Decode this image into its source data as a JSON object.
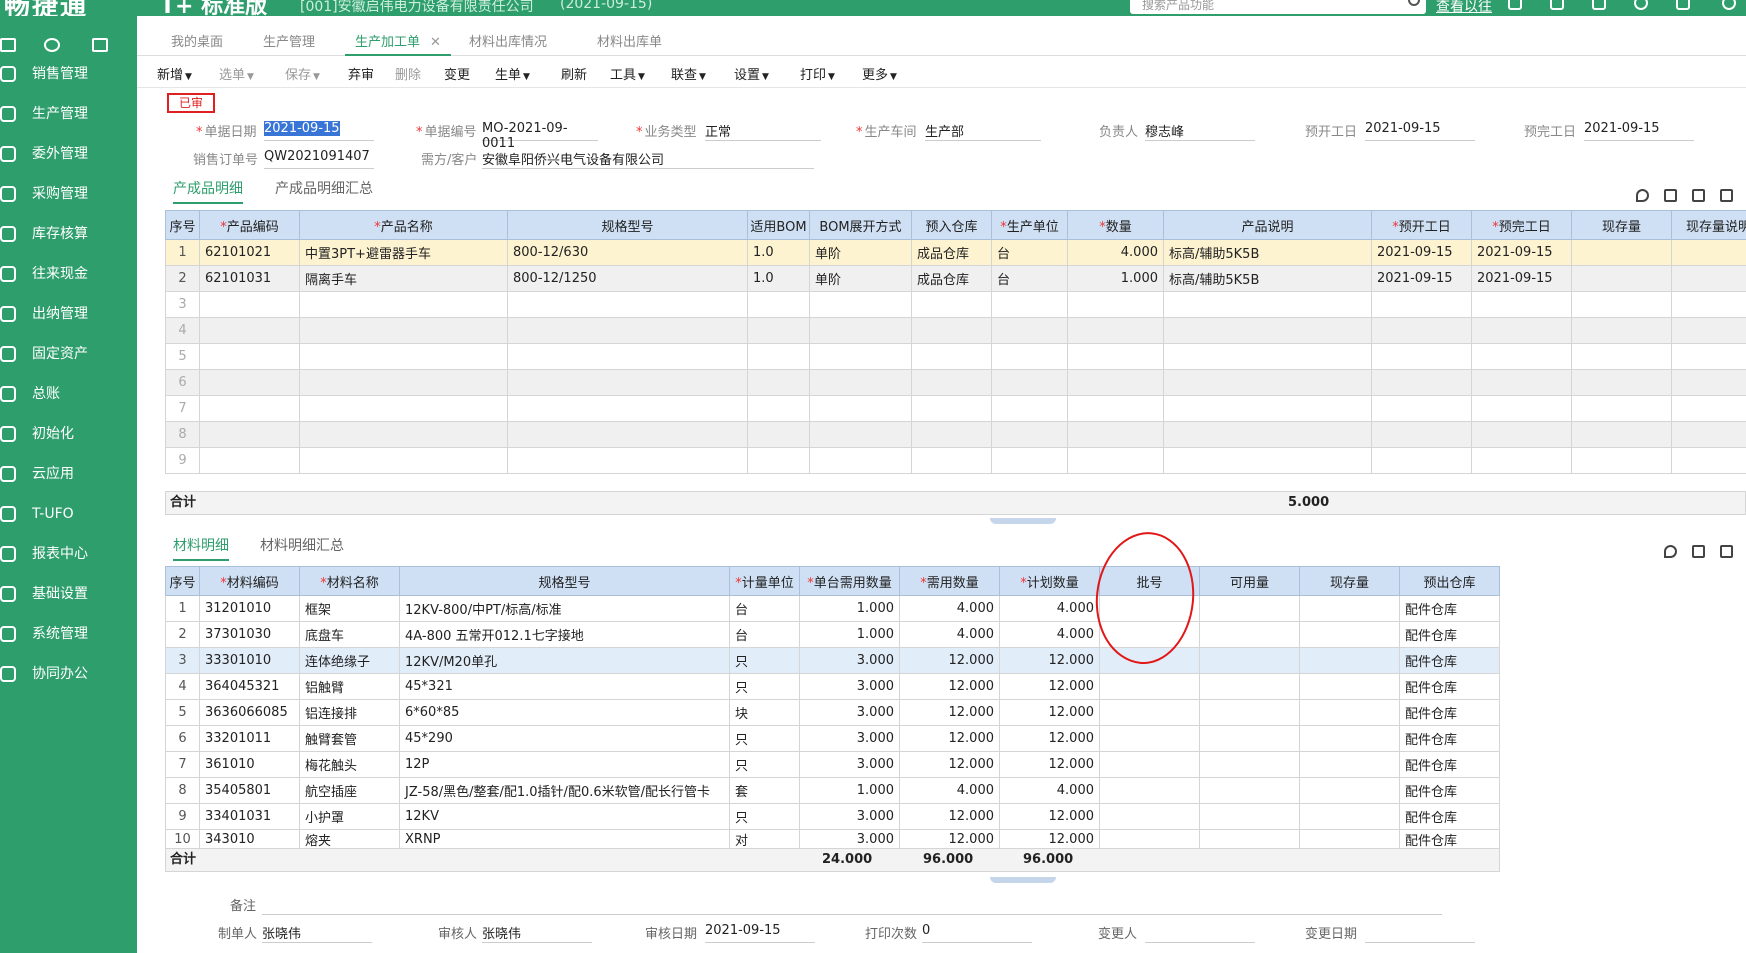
{
  "app": {
    "logo": "畅捷通",
    "edition": "T+ 标准版",
    "company": "[001]安徽启伟电力设备有限责任公司",
    "date": "(2021-09-15)",
    "search_placeholder": "搜索产品功能",
    "help_link": "查看以往"
  },
  "sidebar": {
    "items": [
      {
        "label": "销售管理",
        "icon": "sales-icon"
      },
      {
        "label": "生产管理",
        "icon": "production-icon"
      },
      {
        "label": "委外管理",
        "icon": "outsource-icon"
      },
      {
        "label": "采购管理",
        "icon": "purchase-icon"
      },
      {
        "label": "库存核算",
        "icon": "inventory-icon"
      },
      {
        "label": "往来现金",
        "icon": "cash-icon"
      },
      {
        "label": "出纳管理",
        "icon": "cashier-icon"
      },
      {
        "label": "固定资产",
        "icon": "asset-icon"
      },
      {
        "label": "总账",
        "icon": "ledger-icon"
      },
      {
        "label": "初始化",
        "icon": "init-icon"
      },
      {
        "label": "云应用",
        "icon": "cloud-icon"
      },
      {
        "label": "T-UFO",
        "icon": "ufo-icon"
      },
      {
        "label": "报表中心",
        "icon": "report-icon"
      },
      {
        "label": "基础设置",
        "icon": "basic-settings-icon"
      },
      {
        "label": "系统管理",
        "icon": "system-icon"
      },
      {
        "label": "协同办公",
        "icon": "office-icon"
      }
    ]
  },
  "tabs": [
    "我的桌面",
    "生产管理",
    "生产加工单",
    "材料出库情况",
    "材料出库单"
  ],
  "active_tab": "生产加工单",
  "toolbar": {
    "new": "新增",
    "select": "选单",
    "save": "保存",
    "discard": "弃审",
    "delete": "删除",
    "change": "变更",
    "generate": "生单",
    "refresh": "刷新",
    "tools": "工具",
    "query": "联查",
    "settings": "设置",
    "print": "打印",
    "more": "更多"
  },
  "status_badge": "已审",
  "form": {
    "doc_date_label": "单据日期",
    "doc_date": "2021-09-15",
    "doc_no_label": "单据编号",
    "doc_no": "MO-2021-09-0011",
    "biz_type_label": "业务类型",
    "biz_type": "正常",
    "workshop_label": "生产车间",
    "workshop": "生产部",
    "owner_label": "负责人",
    "owner": "穆志峰",
    "plan_start_label": "预开工日",
    "plan_start": "2021-09-15",
    "plan_end_label": "预完工日",
    "plan_end": "2021-09-15",
    "sales_order_label": "销售订单号",
    "sales_order": "QW2021091407",
    "customer_label": "需方/客户",
    "customer": "安徽阜阳侨兴电气设备有限公司"
  },
  "product_section": {
    "tab_detail": "产成品明细",
    "tab_summary": "产成品明细汇总"
  },
  "product_table": {
    "headers": [
      "序号",
      "产品编码",
      "产品名称",
      "规格型号",
      "适用BOM",
      "BOM展开方式",
      "预入仓库",
      "生产单位",
      "数量",
      "产品说明",
      "预开工日",
      "预完工日",
      "现存量",
      "现存量说明"
    ],
    "rows": [
      [
        "1",
        "62101021",
        "中置3PT+避雷器手车",
        "800-12/630",
        "1.0",
        "单阶",
        "成品仓库",
        "台",
        "4.000",
        "标高/辅助5K5B",
        "2021-09-15",
        "2021-09-15",
        "",
        ""
      ],
      [
        "2",
        "62101031",
        "隔离手车",
        "800-12/1250",
        "1.0",
        "单阶",
        "成品仓库",
        "台",
        "1.000",
        "标高/辅助5K5B",
        "2021-09-15",
        "2021-09-15",
        "",
        ""
      ]
    ],
    "empty_rows": [
      "3",
      "4",
      "5",
      "6",
      "7",
      "8",
      "9"
    ],
    "total_label": "合计",
    "total_qty": "5.000"
  },
  "material_section": {
    "tab_detail": "材料明细",
    "tab_summary": "材料明细汇总"
  },
  "material_table": {
    "headers": [
      "序号",
      "材料编码",
      "材料名称",
      "规格型号",
      "计量单位",
      "单台需用数量",
      "需用数量",
      "计划数量",
      "批号",
      "可用量",
      "现存量",
      "预出仓库"
    ],
    "rows": [
      [
        "1",
        "31201010",
        "框架",
        "12KV-800/中PT/标高/标准",
        "台",
        "1.000",
        "4.000",
        "4.000",
        "",
        "",
        "",
        "配件仓库"
      ],
      [
        "2",
        "37301030",
        "底盘车",
        "4A-800 五常开012.1七字接地",
        "台",
        "1.000",
        "4.000",
        "4.000",
        "",
        "",
        "",
        "配件仓库"
      ],
      [
        "3",
        "33301010",
        "连体绝缘子",
        "12KV/M20单孔",
        "只",
        "3.000",
        "12.000",
        "12.000",
        "",
        "",
        "",
        "配件仓库"
      ],
      [
        "4",
        "364045321",
        "铝触臂",
        "45*321",
        "只",
        "3.000",
        "12.000",
        "12.000",
        "",
        "",
        "",
        "配件仓库"
      ],
      [
        "5",
        "3636066085",
        "铝连接排",
        "6*60*85",
        "块",
        "3.000",
        "12.000",
        "12.000",
        "",
        "",
        "",
        "配件仓库"
      ],
      [
        "6",
        "33201011",
        "触臂套管",
        "45*290",
        "只",
        "3.000",
        "12.000",
        "12.000",
        "",
        "",
        "",
        "配件仓库"
      ],
      [
        "7",
        "361010",
        "梅花触头",
        "12P",
        "只",
        "3.000",
        "12.000",
        "12.000",
        "",
        "",
        "",
        "配件仓库"
      ],
      [
        "8",
        "35405801",
        "航空插座",
        "JZ-58/黑色/整套/配1.0插针/配0.6米软管/配长行管卡",
        "套",
        "1.000",
        "4.000",
        "4.000",
        "",
        "",
        "",
        "配件仓库"
      ],
      [
        "9",
        "33401031",
        "小护罩",
        "12KV",
        "只",
        "3.000",
        "12.000",
        "12.000",
        "",
        "",
        "",
        "配件仓库"
      ],
      [
        "10",
        "343010",
        "熔夹",
        "XRNP",
        "对",
        "3.000",
        "12.000",
        "12.000",
        "",
        "",
        "",
        "配件仓库"
      ]
    ],
    "total_label": "合计",
    "total_unit_qty": "24.000",
    "total_need_qty": "96.000",
    "total_plan_qty": "96.000"
  },
  "footer": {
    "remark_label": "备注",
    "remark": "",
    "maker_label": "制单人",
    "maker": "张晓伟",
    "auditor_label": "审核人",
    "auditor": "张晓伟",
    "audit_date_label": "审核日期",
    "audit_date": "2021-09-15",
    "print_count_label": "打印次数",
    "print_count": "0",
    "changer_label": "变更人",
    "changer": "",
    "change_date_label": "变更日期",
    "change_date": ""
  },
  "colors": {
    "brand": "#2e9e6c",
    "header_bg": "#cfe0f4",
    "annotation": "#e01818"
  }
}
